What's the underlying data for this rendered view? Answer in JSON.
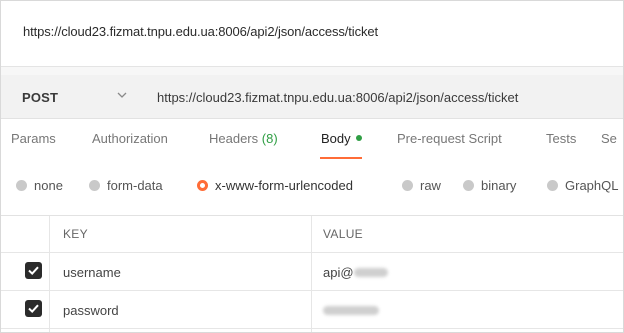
{
  "window": {
    "title_url": "https://cloud23.fizmat.tnpu.edu.ua:8006/api2/json/access/ticket"
  },
  "request": {
    "method": "POST",
    "caret_icon": "chevron-down-icon",
    "url": "https://cloud23.fizmat.tnpu.edu.ua:8006/api2/json/access/ticket"
  },
  "tabs": [
    {
      "label": "Params"
    },
    {
      "label": "Authorization"
    },
    {
      "label": "Headers",
      "count": "(8)"
    },
    {
      "label": "Body",
      "active": true
    },
    {
      "label": "Pre-request Script"
    },
    {
      "label": "Tests"
    },
    {
      "label": "Se"
    }
  ],
  "body_types": [
    {
      "label": "none"
    },
    {
      "label": "form-data"
    },
    {
      "label": "x-www-form-urlencoded",
      "selected": true
    },
    {
      "label": "raw"
    },
    {
      "label": "binary"
    },
    {
      "label": "GraphQL"
    }
  ],
  "kv_table": {
    "headers": {
      "key": "KEY",
      "value": "VALUE"
    },
    "rows": [
      {
        "checked": true,
        "key": "username",
        "value_prefix": "api@"
      },
      {
        "checked": true,
        "key": "password",
        "value_prefix": ""
      }
    ]
  },
  "colors": {
    "accent": "#ff6c37",
    "active_dot": "#2f9e44",
    "checkbox": "#2b2b2b"
  }
}
